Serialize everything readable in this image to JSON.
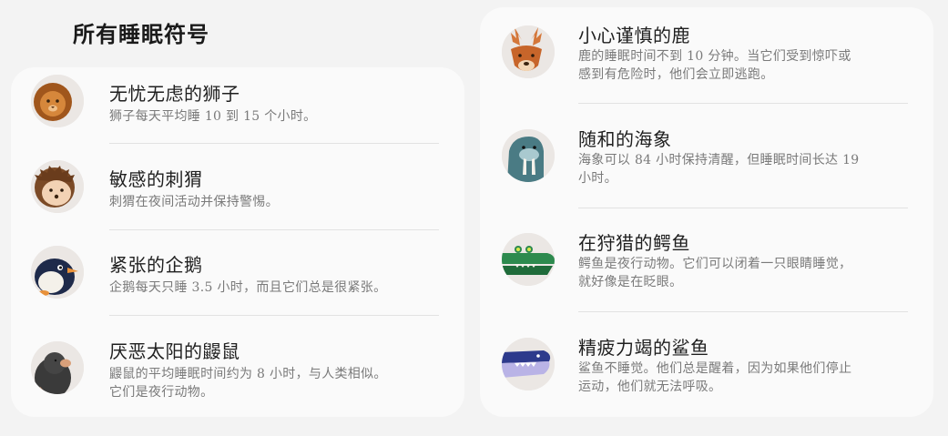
{
  "page": {
    "title": "所有睡眠符号"
  },
  "left_items": [
    {
      "name": "无忧无虑的狮子",
      "desc": "狮子每天平均睡 10 到 15 个小时。",
      "icon": "lion-icon"
    },
    {
      "name": "敏感的刺猬",
      "desc": "刺猬在夜间活动并保持警惕。",
      "icon": "hedgehog-icon"
    },
    {
      "name": "紧张的企鹅",
      "desc": "企鹅每天只睡 3.5 小时，而且它们总是很紧张。",
      "icon": "penguin-icon"
    },
    {
      "name": "厌恶太阳的鼹鼠",
      "desc_line1": "鼹鼠的平均睡眠时间约为 8 小时，与人类相似。",
      "desc_line2": "它们是夜行动物。",
      "icon": "mole-icon"
    }
  ],
  "right_items": [
    {
      "name": "小心谨慎的鹿",
      "desc_line1": "鹿的睡眠时间不到 10 分钟。当它们受到惊吓或",
      "desc_line2": "感到有危险时，他们会立即逃跑。",
      "icon": "deer-icon"
    },
    {
      "name": "随和的海象",
      "desc_line1": "海象可以 84 小时保持清醒，但睡眠时间长达 19",
      "desc_line2": "小时。",
      "icon": "walrus-icon"
    },
    {
      "name": "在狩猎的鳄鱼",
      "desc_line1": "鳄鱼是夜行动物。它们可以闭着一只眼睛睡觉，",
      "desc_line2": "就好像是在眨眼。",
      "icon": "crocodile-icon"
    },
    {
      "name": "精疲力竭的鲨鱼",
      "desc_line1": "鲨鱼不睡觉。他们总是醒着，因为如果他们停止",
      "desc_line2": "运动，他们就无法呼吸。",
      "icon": "shark-icon"
    }
  ]
}
